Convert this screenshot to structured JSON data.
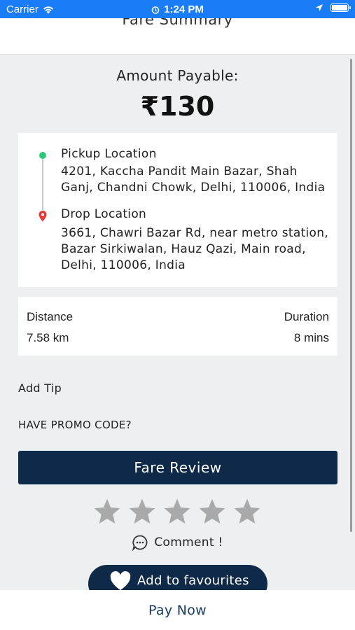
{
  "status_bar": {
    "carrier": "Carrier",
    "time": "1:24 PM",
    "bg_color": "#1a7df7"
  },
  "header": {
    "title": "Fare Summary"
  },
  "fare": {
    "amount_label": "Amount Payable:",
    "amount_value": "₹130"
  },
  "route": {
    "pickup_title": "Pickup Location",
    "pickup_address": "4201, Kaccha Pandit Main Bazar, Shah Ganj, Chandni Chowk, Delhi, 110006, India",
    "drop_title": "Drop Location",
    "drop_address": "3661, Chawri Bazar Rd, near metro station, Bazar Sirkiwalan, Hauz Qazi, Main road, Delhi, 110006, India",
    "pickup_color": "#2ec67a",
    "drop_color": "#e53935"
  },
  "trip": {
    "distance_label": "Distance",
    "distance_value": "7.58 km",
    "duration_label": "Duration",
    "duration_value": "8 mins"
  },
  "extras": {
    "add_tip": "Add Tip",
    "promo": "HAVE PROMO CODE?"
  },
  "actions": {
    "fare_review": "Fare Review",
    "comment": "Comment !",
    "add_favourites": "Add to favourites",
    "pay_now": "Pay Now"
  },
  "rating": {
    "max": 5,
    "value": 0
  },
  "colors": {
    "primary_button": "#0f2a48",
    "star_empty": "#a9a9a9",
    "pay_now_text": "#173a63"
  },
  "icons": [
    "wifi-icon",
    "alarm-icon",
    "location-arrow-icon",
    "battery-icon",
    "pickup-dot-icon",
    "drop-pin-icon",
    "star-icon",
    "comment-icon",
    "heart-icon"
  ]
}
